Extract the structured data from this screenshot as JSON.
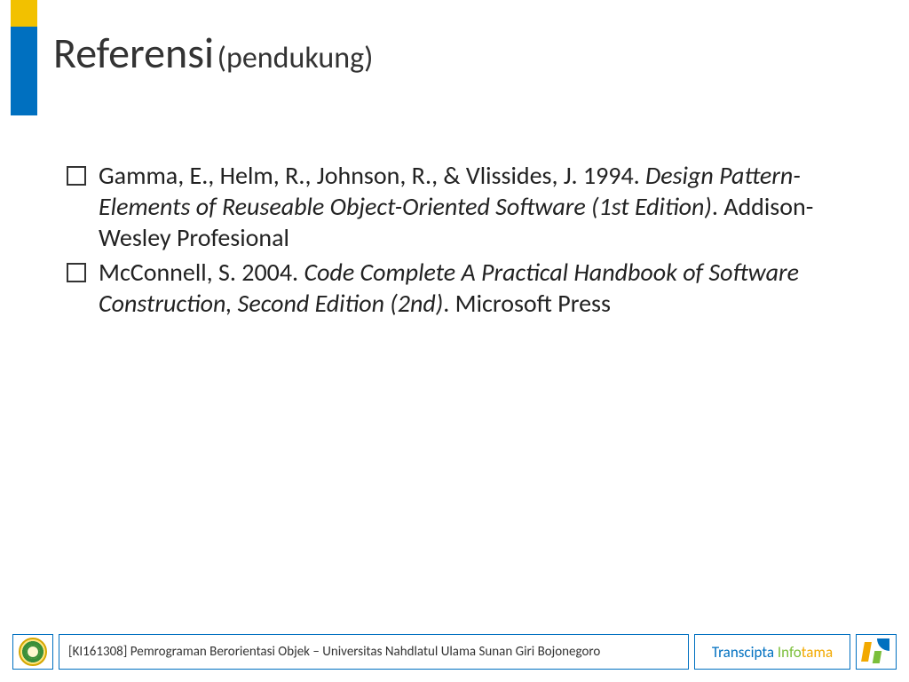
{
  "title": {
    "main": "Referensi",
    "sub": "(pendukung)"
  },
  "references": [
    {
      "prefix": "Gamma, E., Helm, R., Johnson, R., & Vlissides, J. 1994. ",
      "italic": "Design Pattern-Elements of Reuseable Object-Oriented Software (1st Edition)",
      "suffix": ". Addison-Wesley Profesional"
    },
    {
      "prefix": "McConnell, S. 2004. ",
      "italic": "Code Complete A Practical Handbook of Software Construction, Second Edition (2nd)",
      "suffix": ". Microsoft Press"
    }
  ],
  "footer": {
    "course": "[KI161308] Pemrograman Berorientasi Objek – Universitas Nahdlatul Ulama Sunan Giri Bojonegoro",
    "brand": {
      "a": "Transcipta ",
      "b": "Info",
      "c": "tama"
    }
  },
  "colors": {
    "accent": "#0070c0",
    "yellow": "#f2c100",
    "green": "#7bbf3a",
    "orange": "#f2a900"
  }
}
